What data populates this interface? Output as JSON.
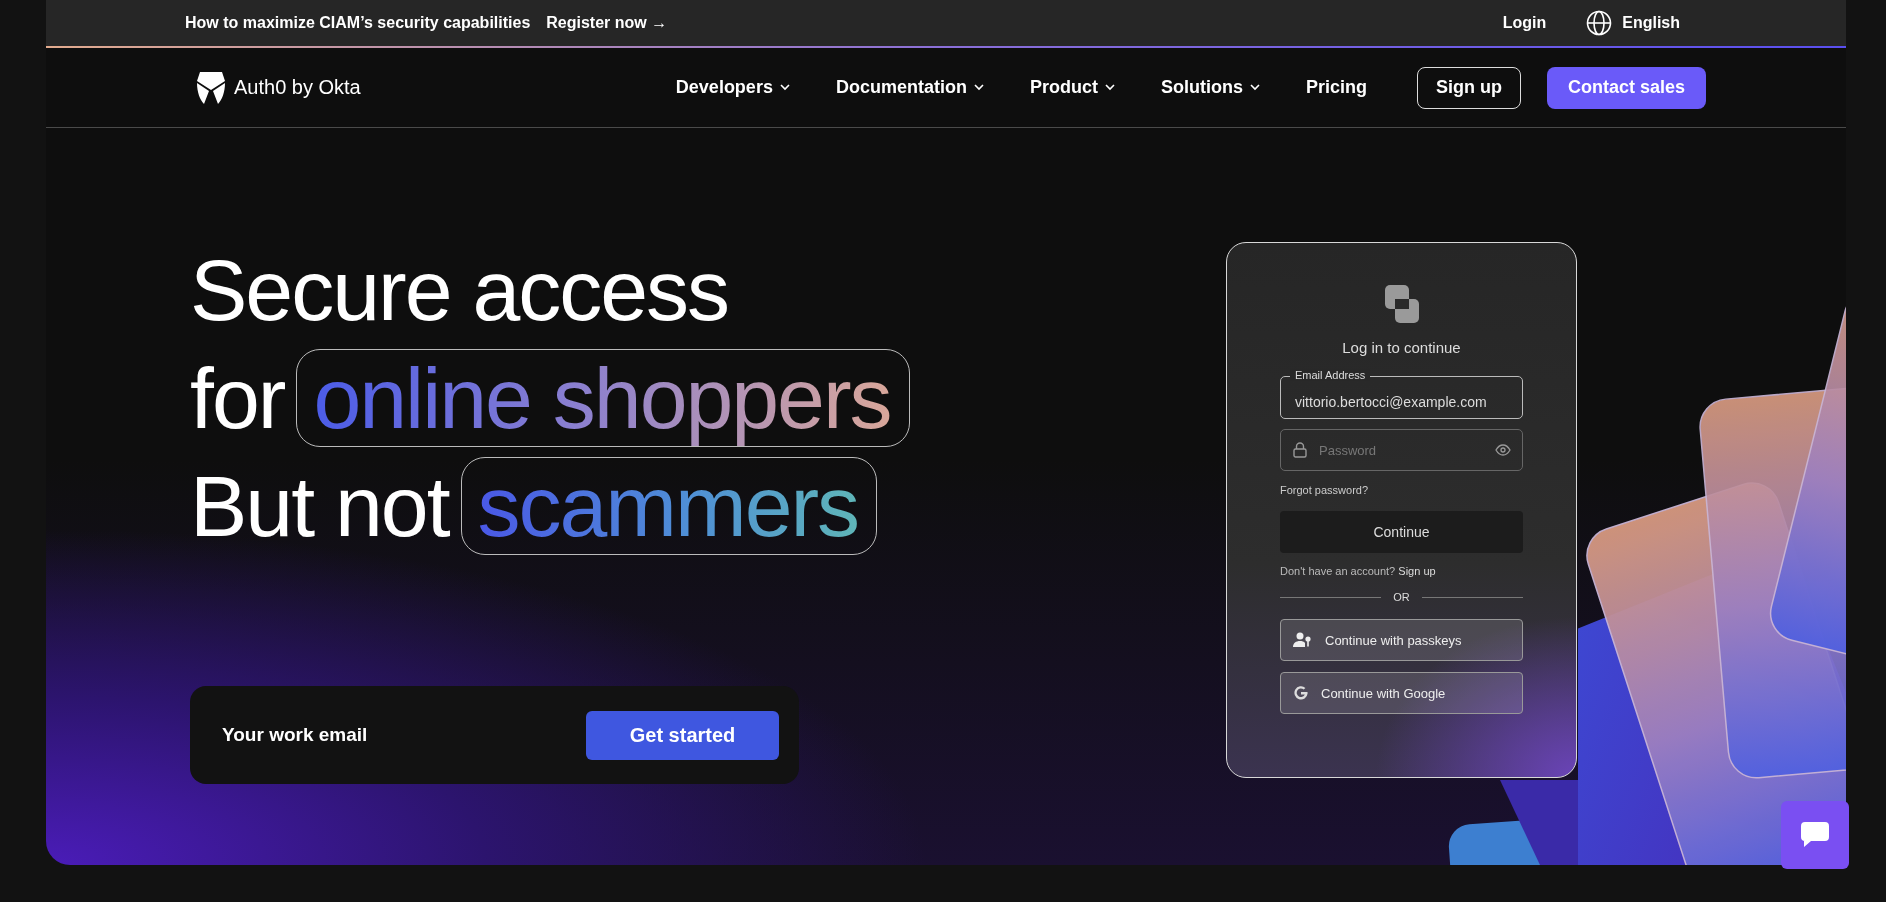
{
  "announcement": {
    "text": "How to maximize CIAM’s security capabilities",
    "link": "Register now →"
  },
  "utility": {
    "login": "Login",
    "language": "English"
  },
  "nav": {
    "logo": "Auth0 by Okta",
    "items": [
      {
        "label": "Developers",
        "has_dropdown": true
      },
      {
        "label": "Documentation",
        "has_dropdown": true
      },
      {
        "label": "Product",
        "has_dropdown": true
      },
      {
        "label": "Solutions",
        "has_dropdown": true
      },
      {
        "label": "Pricing",
        "has_dropdown": false
      }
    ],
    "sign_up": "Sign up",
    "contact": "Contact sales"
  },
  "hero": {
    "headline": [
      {
        "lead": "Secure access"
      },
      {
        "lead": "for",
        "pill": "online shoppers",
        "kind": "warm"
      },
      {
        "lead": "But not",
        "pill": "scammers",
        "kind": "cool"
      }
    ],
    "email_form": {
      "placeholder": "Your work email",
      "button": "Get started"
    }
  },
  "login_card": {
    "title": "Log in to continue",
    "email_label": "Email Address",
    "email_value": "vittorio.bertocci@example.com",
    "password_placeholder": "Password",
    "forgot": "Forgot password?",
    "continue": "Continue",
    "signup_prompt": "Don't have an account?",
    "signup_link": "Sign up",
    "divider": "OR",
    "social": [
      {
        "kind": "passkeys",
        "label": "Continue with passkeys"
      },
      {
        "kind": "google",
        "label": "Continue with Google"
      }
    ]
  }
}
